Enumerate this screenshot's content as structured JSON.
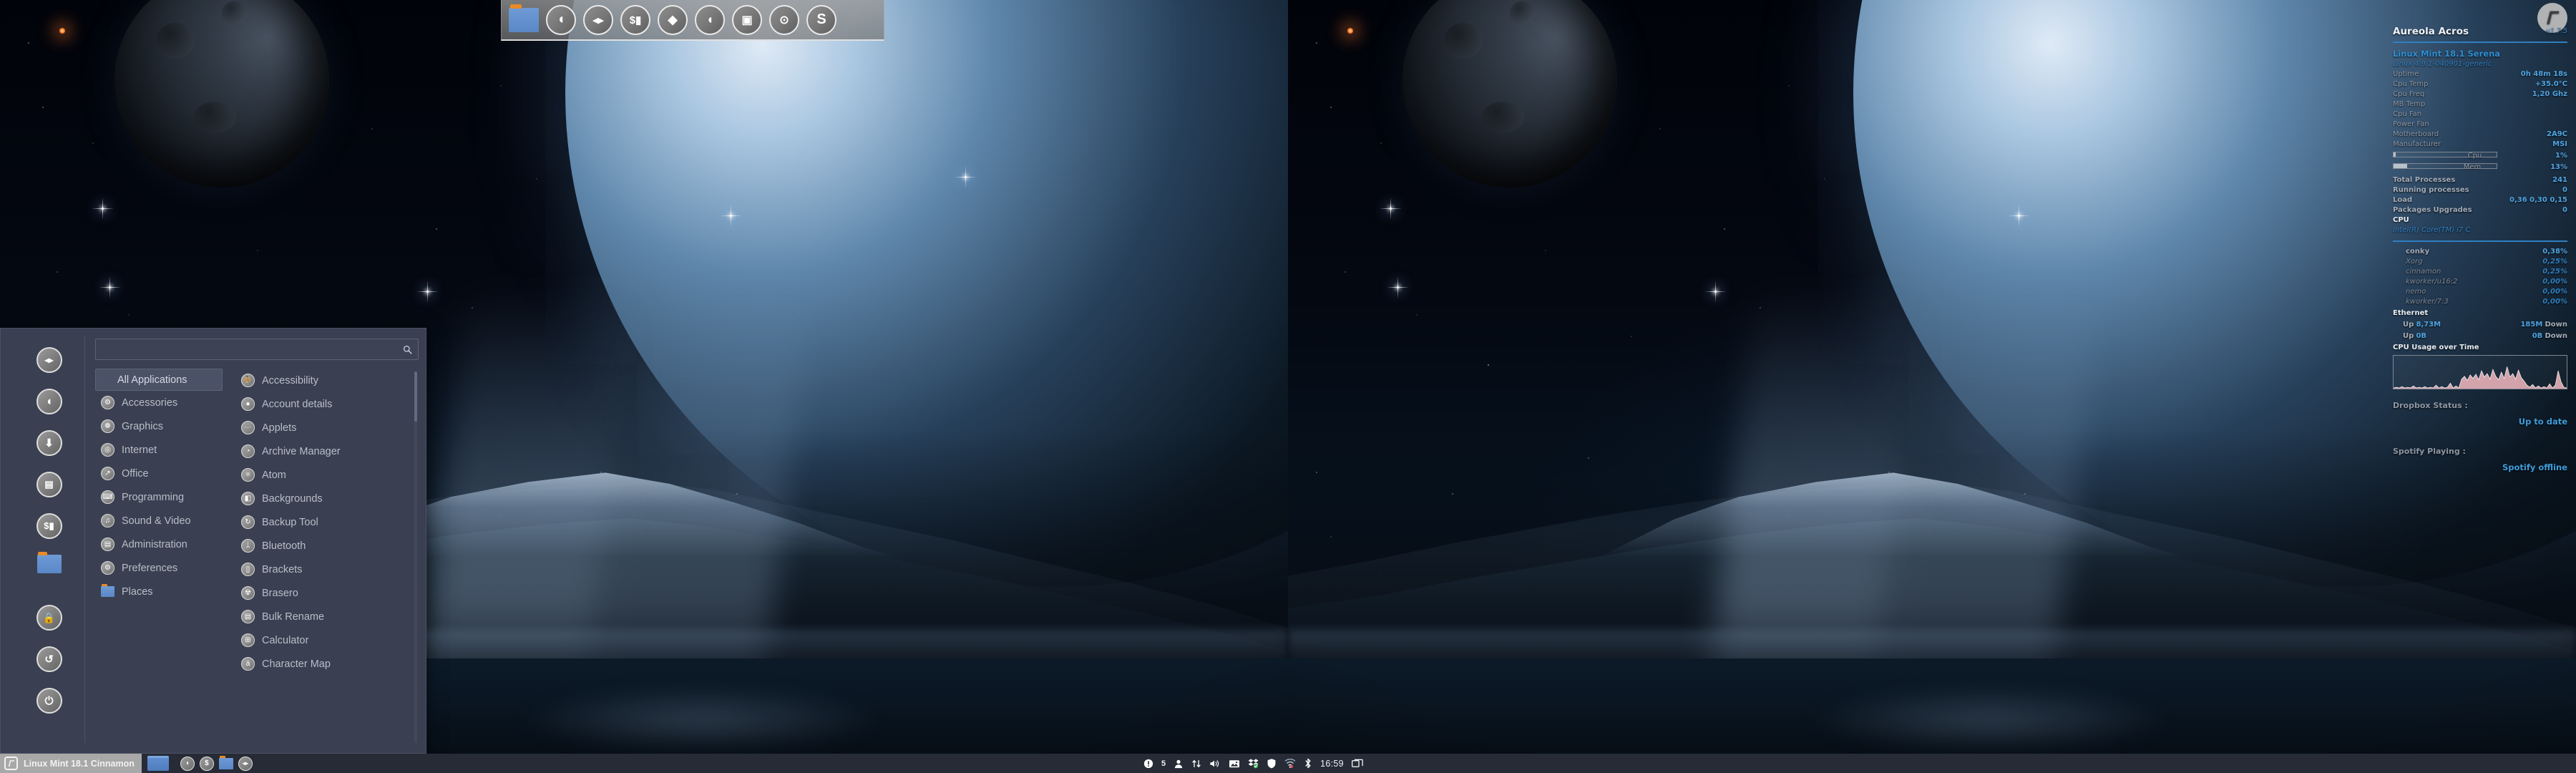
{
  "desktop": {
    "wallpaper_name": "space-moon-planet-mountain-lake"
  },
  "dock": {
    "items": [
      {
        "name": "files-folder",
        "label": "Files",
        "glyph": ""
      },
      {
        "name": "firefox",
        "label": "Firefox",
        "glyph": "◔"
      },
      {
        "name": "multimedia",
        "label": "Multimedia",
        "glyph": "▶"
      },
      {
        "name": "terminal",
        "label": "Terminal",
        "glyph": "$"
      },
      {
        "name": "inkscape",
        "label": "Inkscape",
        "glyph": "◆"
      },
      {
        "name": "gimp",
        "label": "GIMP",
        "glyph": "◖"
      },
      {
        "name": "image-viewer",
        "label": "Image Viewer",
        "glyph": "▣"
      },
      {
        "name": "screenshot",
        "label": "Screenshot",
        "glyph": "⊙"
      },
      {
        "name": "skype",
        "label": "Skype",
        "glyph": "S"
      }
    ]
  },
  "menu": {
    "search": {
      "value": "",
      "placeholder": ""
    },
    "search_icon": "search-icon",
    "favorites": [
      {
        "name": "multimedia",
        "label": "Multimedia",
        "glyph": "▶"
      },
      {
        "name": "firefox",
        "label": "Firefox",
        "glyph": "◔"
      },
      {
        "name": "software-manager",
        "label": "Software Manager",
        "glyph": "⬇"
      },
      {
        "name": "terminal-window",
        "label": "Terminal",
        "glyph": "▤"
      },
      {
        "name": "terminal-dollar",
        "label": "Terminal",
        "glyph": "$"
      },
      {
        "name": "files-folder",
        "label": "Files",
        "glyph": ""
      },
      {
        "name": "lock-screen",
        "label": "Lock Screen",
        "glyph": "ὑ2"
      },
      {
        "name": "logout",
        "label": "Log Out",
        "glyph": "↪"
      },
      {
        "name": "shutdown",
        "label": "Quit",
        "glyph": "⏻"
      }
    ],
    "categories": [
      {
        "label": "All Applications",
        "selected": true,
        "icon": ""
      },
      {
        "label": "Accessories",
        "selected": false,
        "icon": "⚙"
      },
      {
        "label": "Graphics",
        "selected": false,
        "icon": "❁"
      },
      {
        "label": "Internet",
        "selected": false,
        "icon": "◎"
      },
      {
        "label": "Office",
        "selected": false,
        "icon": "↗"
      },
      {
        "label": "Programming",
        "selected": false,
        "icon": "⌨"
      },
      {
        "label": "Sound & Video",
        "selected": false,
        "icon": "♫"
      },
      {
        "label": "Administration",
        "selected": false,
        "icon": "▤"
      },
      {
        "label": "Preferences",
        "selected": false,
        "icon": "⚙"
      },
      {
        "label": "Places",
        "selected": false,
        "icon": "folder"
      }
    ],
    "applications": [
      {
        "label": "Accessibility",
        "icon": "⛹"
      },
      {
        "label": "Account details",
        "icon": "●"
      },
      {
        "label": "Applets",
        "icon": "⋯"
      },
      {
        "label": "Archive Manager",
        "icon": "◔"
      },
      {
        "label": "Atom",
        "icon": "⚛"
      },
      {
        "label": "Backgrounds",
        "icon": "◧"
      },
      {
        "label": "Backup Tool",
        "icon": "↻"
      },
      {
        "label": "Bluetooth",
        "icon": "ʙ"
      },
      {
        "label": "Brackets",
        "icon": "[ ]"
      },
      {
        "label": "Brasero",
        "icon": "☢"
      },
      {
        "label": "Bulk Rename",
        "icon": "▤"
      },
      {
        "label": "Calculator",
        "icon": "⊞"
      },
      {
        "label": "Character Map",
        "icon": "ä"
      }
    ]
  },
  "panel": {
    "menu_button_label": "Linux Mint 18.1 Cinnamon",
    "menu_button_icon": "mint-logo",
    "windows": [
      {
        "name": "nemo-window",
        "label": "Files"
      }
    ],
    "launchers": [
      {
        "name": "firefox",
        "label": "Firefox",
        "glyph": "◔"
      },
      {
        "name": "terminal",
        "label": "Terminal",
        "glyph": "$"
      },
      {
        "name": "files-folder",
        "label": "Files",
        "glyph": ""
      },
      {
        "name": "multimedia",
        "label": "Multimedia",
        "glyph": "▶"
      }
    ],
    "tray": [
      {
        "name": "update-manager-icon",
        "glyph": "!"
      },
      {
        "name": "workspace-count",
        "glyph": "5"
      },
      {
        "name": "user-icon",
        "glyph": "●"
      },
      {
        "name": "network-traffic-icon",
        "glyph": "⇅"
      },
      {
        "name": "volume-icon",
        "glyph": "▶"
      },
      {
        "name": "screenshot-icon",
        "glyph": "▣"
      },
      {
        "name": "dropbox-icon",
        "glyph": "❖"
      },
      {
        "name": "shield-icon",
        "glyph": "⛨"
      },
      {
        "name": "wifi-icon",
        "glyph": "◢"
      },
      {
        "name": "bluetooth-icon",
        "glyph": "ᛦ"
      }
    ],
    "clock": "16:59",
    "show-desktop-icon": "window-stack-icon"
  },
  "conky": {
    "logo": "mint-logo",
    "title": "Aureola Acros",
    "version": "v1.7.5",
    "distro": "Linux Mint 18.1 Serena",
    "kernel": "Linux 4.9.1-040901-generic",
    "stats": [
      {
        "key": "Uptime",
        "value": "0h 48m 18s"
      },
      {
        "key": "Cpu Temp",
        "value": "+35.0°C"
      },
      {
        "key": "Cpu Freq",
        "value": "1,20 Ghz"
      },
      {
        "key": "MB Temp",
        "value": ""
      },
      {
        "key": "Cpu Fan",
        "value": ""
      },
      {
        "key": "Power Fan",
        "value": ""
      },
      {
        "key": "Motherboard",
        "value": "2A9C"
      },
      {
        "key": "Manufacturer",
        "value": "MSI"
      }
    ],
    "bars": [
      {
        "key": "Cpu",
        "value": "1%",
        "pct": 2
      },
      {
        "key": "Mem",
        "value": "13%",
        "pct": 13
      }
    ],
    "stats2": [
      {
        "key": "Total Processes",
        "value": "241"
      },
      {
        "key": "Running processes",
        "value": "0"
      },
      {
        "key": "Load",
        "value": "0,36 0,30 0,15"
      },
      {
        "key": "Packages Upgrades",
        "value": "0"
      }
    ],
    "cpu_header": "CPU",
    "cpu_name": "Intel(R) Core(TM) i7 C",
    "processes": [
      {
        "name": "conky",
        "value": "0,38%"
      },
      {
        "name": "Xorg",
        "value": "0,25%"
      },
      {
        "name": "cinnamon",
        "value": "0,25%"
      },
      {
        "name": "kworker/u16:2",
        "value": "0,00%"
      },
      {
        "name": "nemo",
        "value": "0,00%"
      },
      {
        "name": "kworker/7:3",
        "value": "0,00%"
      }
    ],
    "net": {
      "header": "Ethernet",
      "up_label": "Up",
      "up_value": "8,73M",
      "down_value": "185M",
      "down_label": "Down"
    },
    "net2": {
      "up_label": "Up",
      "up_value": "0B",
      "down_value": "0B",
      "down_label": "Down"
    },
    "graph_title": "CPU Usage over Time",
    "dropbox_label": "Dropbox Status :",
    "dropbox_value": "Up to date",
    "spotify_label": "Spotify Playing :",
    "spotify_value": "Spotify offline",
    "colors": {
      "accent": "#2f8fd4",
      "value": "#4ea3e0",
      "key": "#8e96a2",
      "graph": "#f3b9c0"
    }
  }
}
